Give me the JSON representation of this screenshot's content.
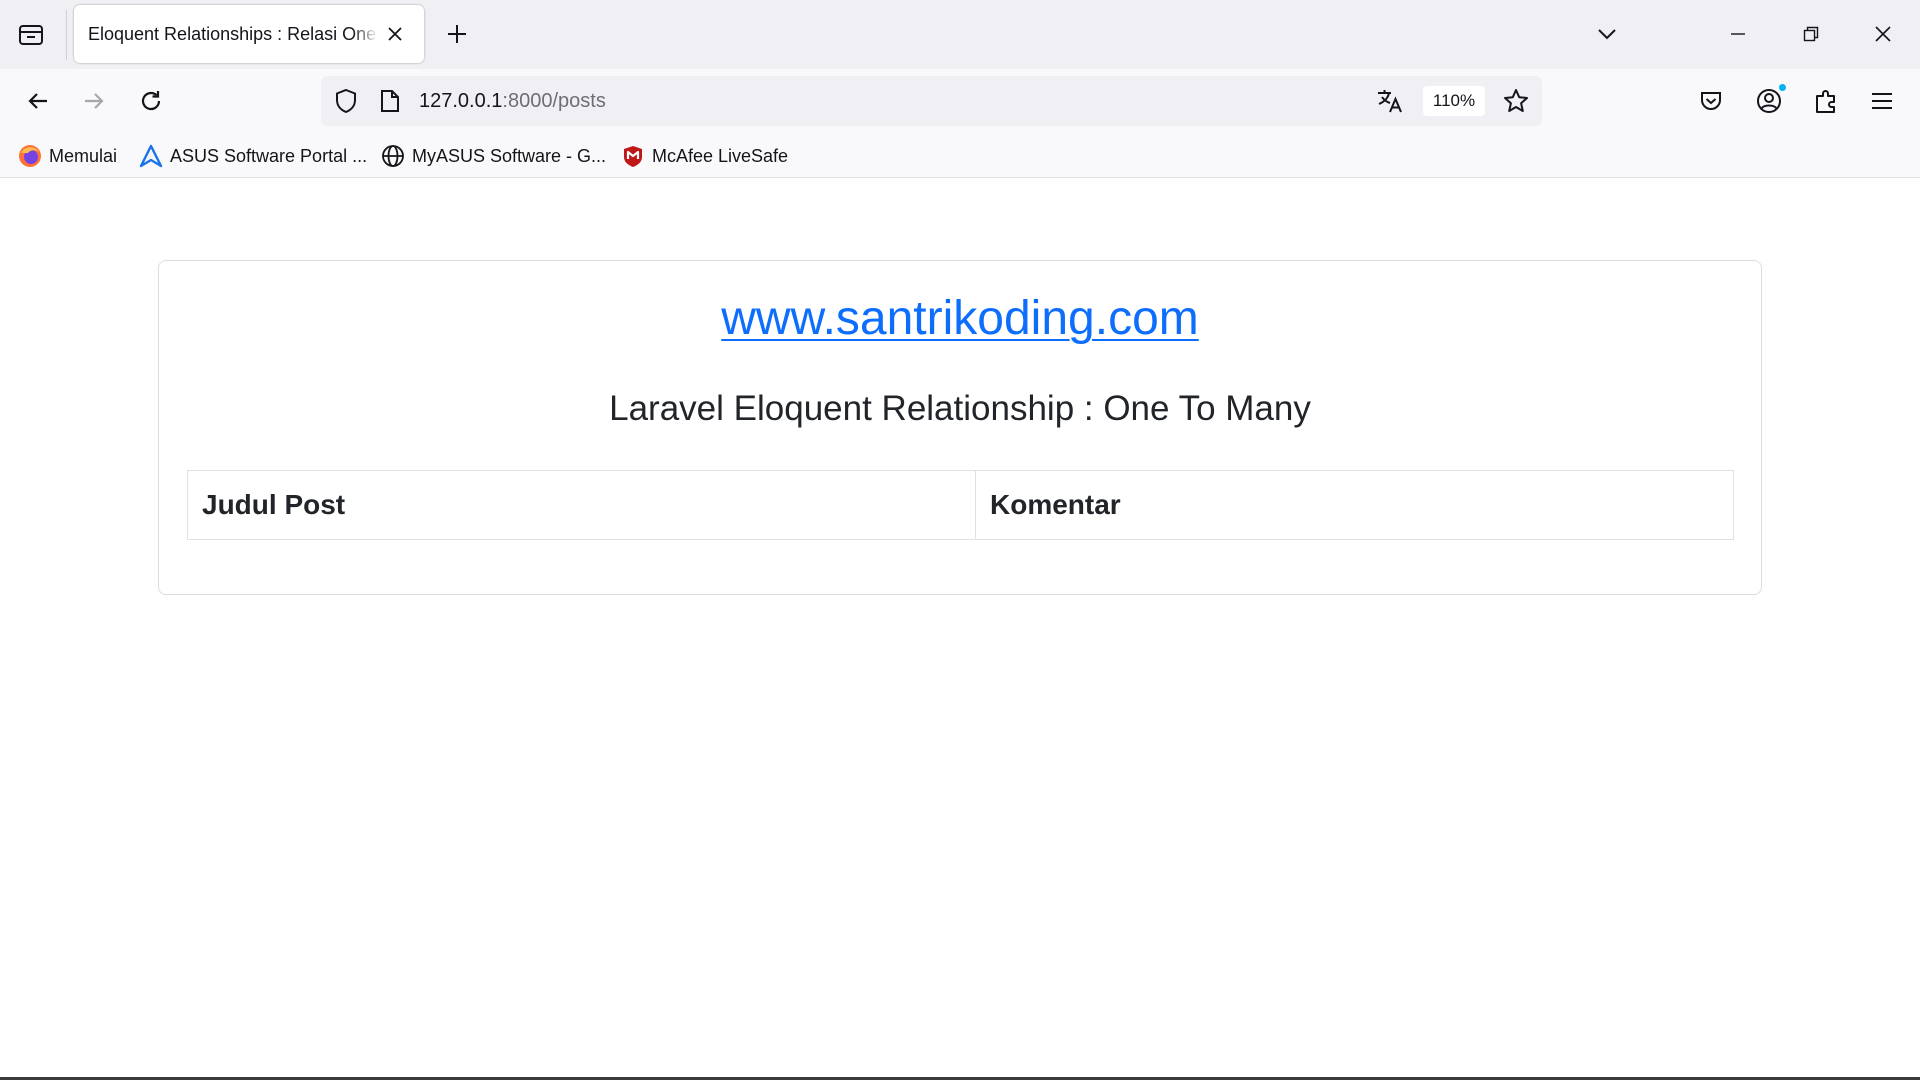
{
  "browser": {
    "tab": {
      "title": "Eloquent Relationships : Relasi One to Many"
    },
    "nav": {
      "url_host": "127.0.0.1",
      "url_path": ":8000/posts",
      "zoom": "110%"
    },
    "bookmarks": [
      {
        "label": "Memulai",
        "icon": "firefox-icon"
      },
      {
        "label": "ASUS Software Portal ...",
        "icon": "asus-icon"
      },
      {
        "label": "MyASUS Software - G...",
        "icon": "globe-icon"
      },
      {
        "label": "McAfee LiveSafe",
        "icon": "mcafee-icon"
      }
    ]
  },
  "page": {
    "site_link": "www.santrikoding.com",
    "subtitle": "Laravel Eloquent Relationship : One To Many",
    "table": {
      "headers": [
        "Judul Post",
        "Komentar"
      ],
      "rows": []
    }
  },
  "colors": {
    "link": "#0d6efd",
    "text": "#212529",
    "tab_strip": "#f0f0f4",
    "toolbar": "#f9f9fb",
    "notification_dot": "#00b3f4"
  }
}
